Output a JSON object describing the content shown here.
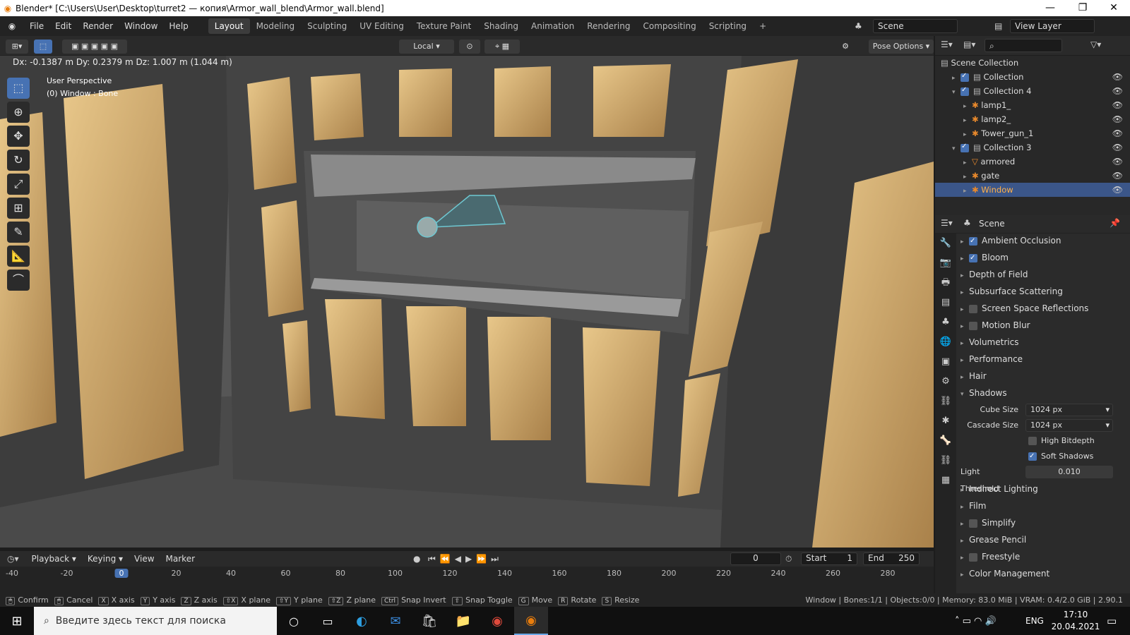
{
  "window": {
    "title": "Blender* [C:\\Users\\User\\Desktop\\turret2 — копия\\Armor_wall_blend\\Armor_wall.blend]",
    "minimize": "—",
    "maximize": "❐",
    "close": "✕"
  },
  "menu": [
    "File",
    "Edit",
    "Render",
    "Window",
    "Help"
  ],
  "workspaces": [
    "Layout",
    "Modeling",
    "Sculpting",
    "UV Editing",
    "Texture Paint",
    "Shading",
    "Animation",
    "Rendering",
    "Compositing",
    "Scripting"
  ],
  "scene": "Scene",
  "view_layer": "View Layer",
  "viewport": {
    "header_info": "Dx: -0.1387 m  Dy: 0.2379 m  Dz: 1.007 m (1.044 m)",
    "orientation": "Local",
    "pose_options": "Pose Options",
    "perspective": "User Perspective",
    "object_info": "(0) Window : Bone"
  },
  "outliner": {
    "scene_collection": "Scene Collection",
    "items": [
      "Collection",
      "Collection 4",
      "lamp1_",
      "lamp2_",
      "Tower_gun_1",
      "Collection 3",
      "armored",
      "gate",
      "Window"
    ]
  },
  "properties": {
    "header": "Scene",
    "panels": [
      "Ambient Occlusion",
      "Bloom",
      "Depth of Field",
      "Subsurface Scattering",
      "Screen Space Reflections",
      "Motion Blur",
      "Volumetrics",
      "Performance",
      "Hair",
      "Shadows"
    ],
    "cube_size_label": "Cube Size",
    "cube_size": "1024 px",
    "cascade_size_label": "Cascade Size",
    "cascade_size": "1024 px",
    "high_bitdepth": "High Bitdepth",
    "soft_shadows": "Soft Shadows",
    "light_threshold_label": "Light Threshold",
    "light_threshold": "0.010",
    "panels2": [
      "Indirect Lighting",
      "Film",
      "Simplify",
      "Grease Pencil",
      "Freestyle",
      "Color Management"
    ]
  },
  "timeline": {
    "playback": "Playback",
    "keying": "Keying",
    "view": "View",
    "marker": "Marker",
    "current": "0",
    "start_label": "Start",
    "start": "1",
    "end_label": "End",
    "end": "250",
    "ticks": [
      "-40",
      "-20",
      "0",
      "20",
      "40",
      "60",
      "80",
      "100",
      "120",
      "140",
      "160",
      "180",
      "200",
      "220",
      "240",
      "260",
      "280"
    ]
  },
  "statusbar": {
    "items": [
      [
        "",
        "Confirm"
      ],
      [
        "",
        "Cancel"
      ],
      [
        "X",
        "X axis"
      ],
      [
        "Y",
        "Y axis"
      ],
      [
        "Z",
        "Z axis"
      ],
      [
        "⇧X",
        "X plane"
      ],
      [
        "⇧Y",
        "Y plane"
      ],
      [
        "⇧Z",
        "Z plane"
      ],
      [
        "Ctrl",
        "Snap Invert"
      ],
      [
        "⇧",
        "Snap Toggle"
      ],
      [
        "G",
        "Move"
      ],
      [
        "R",
        "Rotate"
      ],
      [
        "S",
        "Resize"
      ]
    ],
    "info": "Window | Bones:1/1 | Objects:0/0 | Memory: 83.0 MiB | VRAM: 0.4/2.0 GiB | 2.90.1"
  },
  "taskbar": {
    "search_placeholder": "Введите здесь текст для поиска",
    "lang": "ENG",
    "time": "17:10",
    "date": "20.04.2021"
  }
}
